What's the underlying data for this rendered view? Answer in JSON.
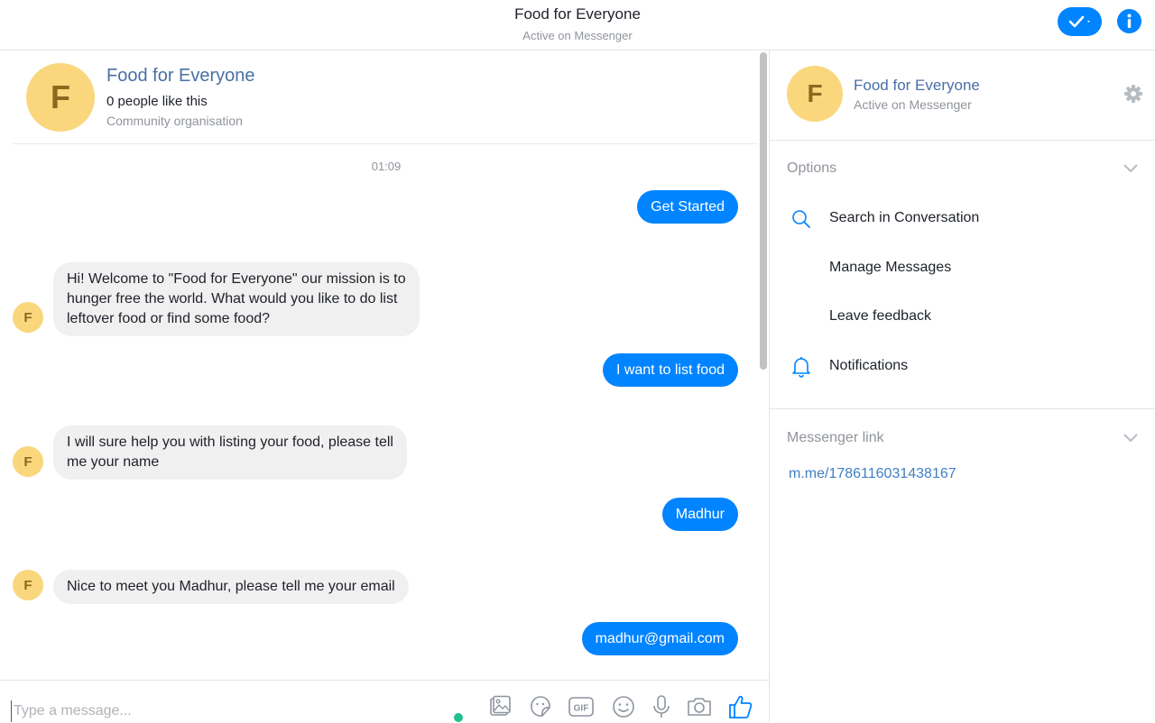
{
  "header": {
    "title": "Food for Everyone",
    "subtitle": "Active on Messenger"
  },
  "conversation": {
    "page": {
      "avatar_letter": "F",
      "name": "Food for Everyone",
      "likes": "0 people like this",
      "category": "Community organisation"
    },
    "timestamp": "01:09",
    "messages": [
      {
        "from": "user",
        "text": "Get Started"
      },
      {
        "from": "page",
        "lines": [
          "Hi! Welcome to \"Food for Everyone\" our mission is to",
          "hunger free the world. What would you like to do list",
          "leftover food or find some food?"
        ]
      },
      {
        "from": "user",
        "text": "I want to list food"
      },
      {
        "from": "page",
        "lines": [
          "I will sure help you with listing your food, please tell",
          "me your name"
        ]
      },
      {
        "from": "user",
        "text": "Madhur"
      },
      {
        "from": "page",
        "lines": [
          "Nice to meet you Madhur, please tell me your email"
        ]
      },
      {
        "from": "user",
        "text": "madhur@gmail.com"
      }
    ],
    "avatar_letter": "F"
  },
  "composer": {
    "placeholder": "Type a message...",
    "icons": [
      "image-icon",
      "sticker-icon",
      "gif-icon",
      "emoji-icon",
      "microphone-icon",
      "camera-icon",
      "thumbs-up-icon"
    ]
  },
  "sidebar": {
    "avatar_letter": "F",
    "name": "Food for Everyone",
    "status": "Active on Messenger",
    "options_title": "Options",
    "options": [
      {
        "label": "Search in Conversation",
        "icon": "search-icon"
      },
      {
        "label": "Manage Messages",
        "icon": ""
      },
      {
        "label": "Leave feedback",
        "icon": ""
      },
      {
        "label": "Notifications",
        "icon": "bell-icon"
      }
    ],
    "link_title": "Messenger link",
    "link": "m.me/1786116031438167"
  },
  "colors": {
    "accent": "#0084ff",
    "avatar_bg": "#fad67d",
    "incoming_bubble": "#f1f0f0",
    "online": "#1fbf8f"
  }
}
